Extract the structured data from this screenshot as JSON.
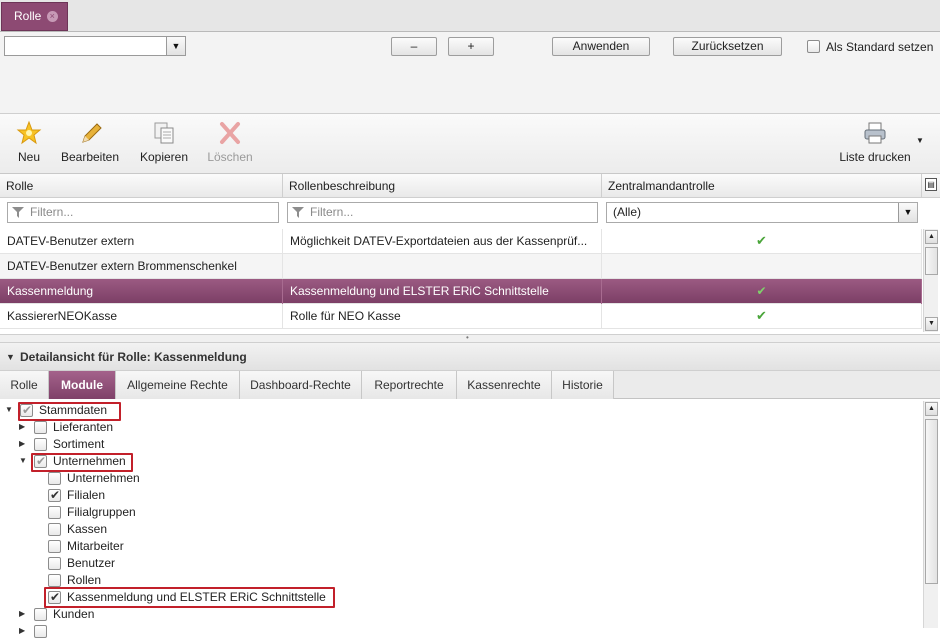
{
  "tab": {
    "label": "Rolle",
    "close": "×"
  },
  "filterbar": {
    "combo_value": "",
    "minus_label": "–",
    "plus_label": "+",
    "apply_label": "Anwenden",
    "reset_label": "Zurücksetzen",
    "default_label": "Als Standard setzen"
  },
  "toolbar": {
    "new_label": "Neu",
    "edit_label": "Bearbeiten",
    "copy_label": "Kopieren",
    "delete_label": "Löschen",
    "print_label": "Liste drucken"
  },
  "grid": {
    "columns": [
      "Rolle",
      "Rollenbeschreibung",
      "Zentralmandantrolle"
    ],
    "filter_placeholder": "Filtern...",
    "filter_select_value": "(Alle)",
    "rows": [
      {
        "role": "DATEV-Benutzer extern",
        "desc": "Möglichkeit DATEV-Exportdateien aus der Kassenprüf...",
        "central": "✔"
      },
      {
        "role": "DATEV-Benutzer extern Brommenschenkel",
        "desc": "",
        "central": ""
      },
      {
        "role": "Kassenmeldung",
        "desc": "Kassenmeldung und ELSTER ERiC Schnittstelle",
        "central": "✔"
      },
      {
        "role": "KassiererNEOKasse",
        "desc": "Rolle für NEO Kasse",
        "central": "✔"
      }
    ]
  },
  "detail": {
    "title": "Detailansicht für Rolle: Kassenmeldung",
    "tabs": [
      "Rolle",
      "Module",
      "Allgemeine Rechte",
      "Dashboard-Rechte",
      "Reportrechte",
      "Kassenrechte",
      "Historie"
    ],
    "active_tab": "Module"
  },
  "tree": [
    {
      "label": "Stammdaten",
      "level": 0,
      "expanded": true,
      "state": "partial",
      "highlight": true
    },
    {
      "label": "Lieferanten",
      "level": 1,
      "expanded": false,
      "state": "off"
    },
    {
      "label": "Sortiment",
      "level": 1,
      "expanded": false,
      "state": "off"
    },
    {
      "label": "Unternehmen",
      "level": 1,
      "expanded": true,
      "state": "partial",
      "highlight": true
    },
    {
      "label": "Unternehmen",
      "level": 2,
      "state": "off"
    },
    {
      "label": "Filialen",
      "level": 2,
      "state": "on"
    },
    {
      "label": "Filialgruppen",
      "level": 2,
      "state": "off"
    },
    {
      "label": "Kassen",
      "level": 2,
      "state": "off"
    },
    {
      "label": "Mitarbeiter",
      "level": 2,
      "state": "off"
    },
    {
      "label": "Benutzer",
      "level": 2,
      "state": "off"
    },
    {
      "label": "Rollen",
      "level": 2,
      "state": "off"
    },
    {
      "label": "Kassenmeldung und ELSTER ERiC Schnittstelle",
      "level": 2,
      "state": "on",
      "highlight": true
    },
    {
      "label": "Kunden",
      "level": 1,
      "expanded": false,
      "state": "off"
    }
  ]
}
